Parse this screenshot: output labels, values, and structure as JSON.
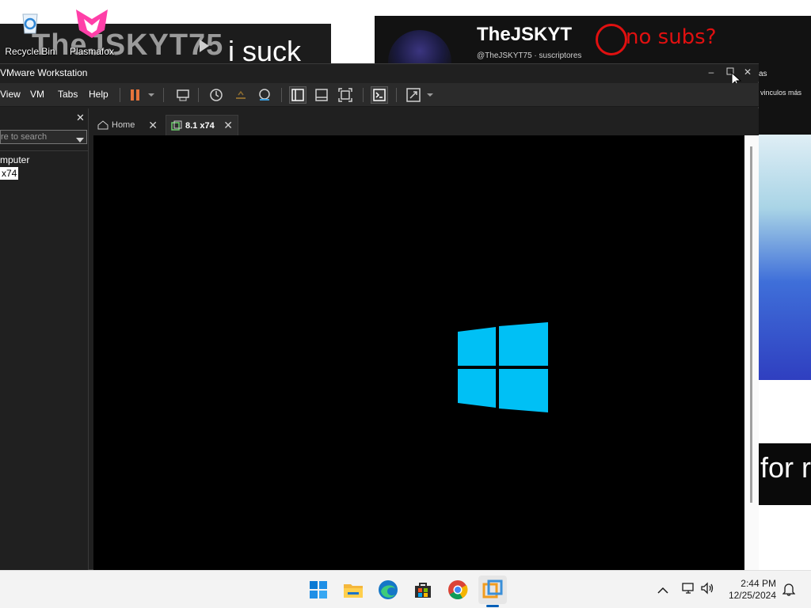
{
  "wallpaper": {
    "left_banner_text": "TheJSKYT75",
    "left_banner_suffix": "i suck",
    "channel_name": "TheJSKYT",
    "channel_subline": "@TheJSKYT75 · suscriptores",
    "handwritten_note": "no subs?",
    "side_text": "vinculos más",
    "side_text_top": "as",
    "bottom_text": "for r"
  },
  "desktop": {
    "icons": [
      {
        "label": "Recycle Bin",
        "icon": "recycle-bin-icon"
      },
      {
        "label": "Plasmafox",
        "icon": "plasmafox-icon"
      }
    ]
  },
  "vmware": {
    "title": "VMware Workstation",
    "menu": [
      "View",
      "VM",
      "Tabs",
      "Help"
    ],
    "library": {
      "search_placeholder": "re to search",
      "tree": [
        "mputer",
        "x74"
      ]
    },
    "tabs": [
      {
        "label": "Home",
        "icon": "home-icon",
        "active": false
      },
      {
        "label": "8.1 x74",
        "icon": "vm-icon",
        "active": true
      }
    ],
    "vm_screen": {
      "logo": "windows-logo",
      "logo_color": "#00c0f5",
      "background": "#000000"
    }
  },
  "taskbar": {
    "apps": [
      {
        "name": "start",
        "icon": "windows-start-icon"
      },
      {
        "name": "file-explorer",
        "icon": "folder-icon"
      },
      {
        "name": "edge",
        "icon": "edge-icon"
      },
      {
        "name": "store",
        "icon": "store-icon"
      },
      {
        "name": "chrome",
        "icon": "chrome-icon"
      },
      {
        "name": "vmware",
        "icon": "vmware-icon",
        "running": true
      }
    ],
    "time": "2:44 PM",
    "date": "12/25/2024",
    "accent": "#005fb8"
  }
}
